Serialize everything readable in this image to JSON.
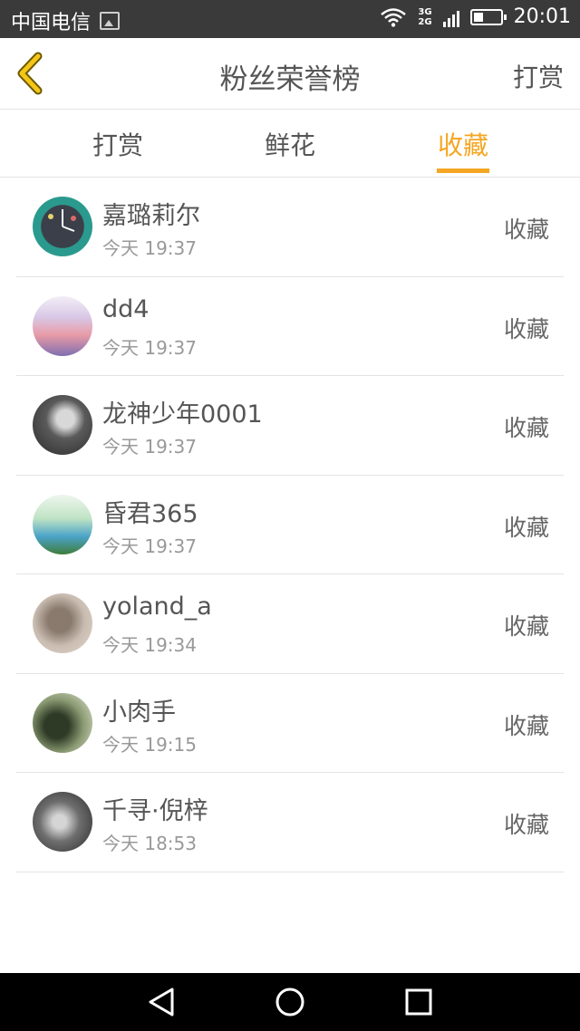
{
  "status_bar": {
    "carrier": "中国电信",
    "network_top": "3G",
    "network_bottom": "2G",
    "time": "20:01"
  },
  "header": {
    "title": "粉丝荣誉榜",
    "right_link": "打赏"
  },
  "tabs": [
    {
      "label": "打赏",
      "active": false
    },
    {
      "label": "鲜花",
      "active": false
    },
    {
      "label": "收藏",
      "active": true
    }
  ],
  "accent_color": "#f5a623",
  "list": [
    {
      "name": "嘉璐莉尔",
      "time": "今天 19:37",
      "action": "收藏"
    },
    {
      "name": "dd4",
      "time": "今天 19:37",
      "action": "收藏"
    },
    {
      "name": "龙神少年0001",
      "time": "今天 19:37",
      "action": "收藏"
    },
    {
      "name": "昏君365",
      "time": "今天 19:37",
      "action": "收藏"
    },
    {
      "name": "yoland_a",
      "time": "今天 19:34",
      "action": "收藏"
    },
    {
      "name": "小肉手",
      "time": "今天 19:15",
      "action": "收藏"
    },
    {
      "name": "千寻·倪梓",
      "time": "今天 18:53",
      "action": "收藏"
    }
  ],
  "nav_icons": [
    "back-triangle-icon",
    "home-circle-icon",
    "recents-square-icon"
  ]
}
